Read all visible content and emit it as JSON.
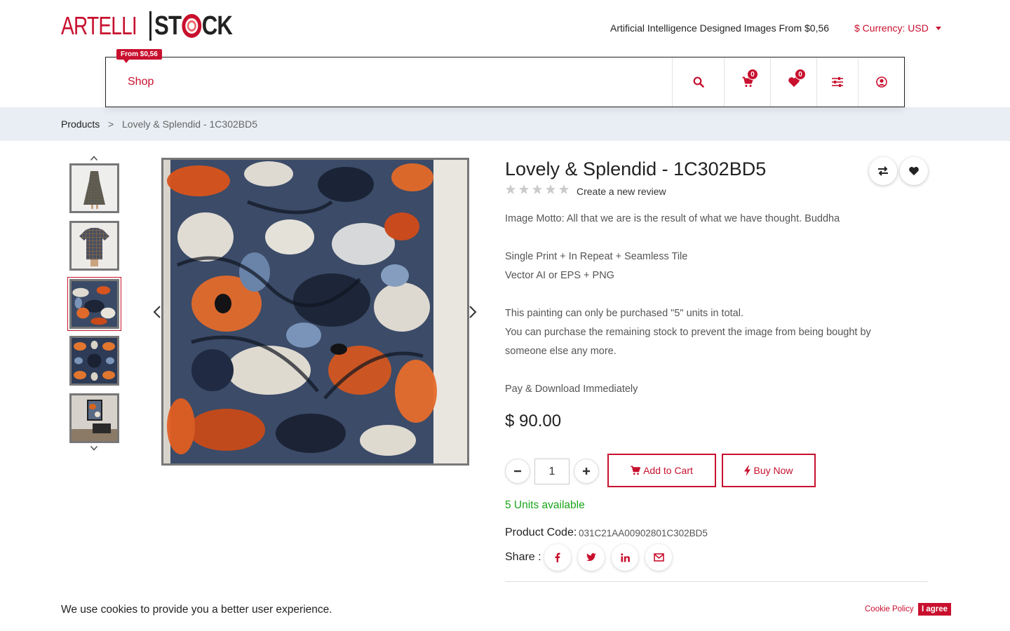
{
  "header": {
    "logo_left": "ARTELLI",
    "logo_right_a": "ST",
    "logo_right_b": "CK",
    "tagline": "Artificial Intelligence Designed Images From $0,56",
    "currency_label": "$ Currency: USD"
  },
  "nav": {
    "badge": "From $0,56",
    "shop_label": "Shop",
    "cart_count": "0",
    "wishlist_count": "0",
    "icons": [
      "search-icon",
      "cart-icon",
      "heart-icon",
      "sliders-icon",
      "user-icon"
    ]
  },
  "breadcrumb": {
    "root": "Products",
    "separator": ">",
    "current": "Lovely & Splendid - 1C302BD5"
  },
  "gallery": {
    "thumbnails": [
      "dress",
      "t-shirt",
      "painting",
      "tile-pattern",
      "room-frame"
    ],
    "active_index": 2
  },
  "product": {
    "title": "Lovely & Splendid - 1C302BD5",
    "rating_stars": 0,
    "review_link": "Create a new review",
    "motto": "Image Motto: All that we are is the result of what we have thought. Buddha",
    "format_line1": "Single Print + In Repeat + Seamless Tile",
    "format_line2": "Vector AI or EPS + PNG",
    "limit_line1": "This painting can only be purchased \"5\" units in total.",
    "limit_line2": "You can purchase the remaining stock to prevent the image from being bought by",
    "limit_line3": "someone else any more.",
    "pay_line": "Pay & Download Immediately",
    "price": "$ 90.00",
    "quantity": "1",
    "add_to_cart": "Add to Cart",
    "buy_now": "Buy Now",
    "units_available": "5 Units available",
    "code_label": "Product Code:",
    "code_value": "031C21AA00902801C302BD5",
    "share_label": "Share :"
  },
  "cookie": {
    "text": "We use cookies to provide you a better user experience.",
    "policy_link": "Cookie Policy",
    "agree_button": "I agree"
  },
  "colors": {
    "accent": "#c8102e",
    "success": "#1aa51a",
    "breadcrumb_bg": "#e9eef4"
  }
}
